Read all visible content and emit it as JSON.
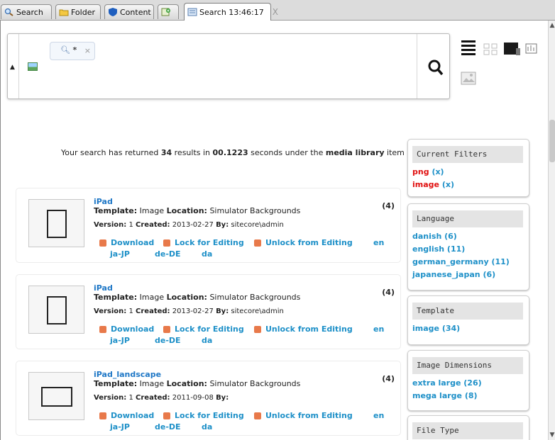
{
  "tabs": [
    {
      "label": "Search",
      "icon": "search-icon"
    },
    {
      "label": "Folder",
      "icon": "folder-icon"
    },
    {
      "label": "Content",
      "icon": "content-shield-icon"
    },
    {
      "label": "",
      "icon": "add-tab-icon"
    },
    {
      "label": "Search 13:46:17",
      "icon": "search-tab-icon",
      "close": "X"
    }
  ],
  "search": {
    "query": "*",
    "clear": "×"
  },
  "results": {
    "prefix": "Your search has returned ",
    "count": "34",
    "mid": " results in ",
    "time": "00.1223",
    "mid2": " seconds under the ",
    "location": "media library",
    "suffix": " item"
  },
  "items": [
    {
      "name": "iPad",
      "template_label": "Template:",
      "template": "Image",
      "location_label": "Location:",
      "location": "Simulator Backgrounds",
      "version_label": "Version:",
      "version": "1",
      "created_label": "Created:",
      "created": "2013-02-27",
      "by_label": "By:",
      "by": "sitecore\\admin",
      "count": "(4)",
      "download": "Download",
      "lock": "Lock for Editing",
      "unlock": "Unlock from Editing",
      "langs": [
        "en",
        "ja-JP",
        "de-DE",
        "da"
      ]
    },
    {
      "name": "iPad",
      "template_label": "Template:",
      "template": "Image",
      "location_label": "Location:",
      "location": "Simulator Backgrounds",
      "version_label": "Version:",
      "version": "1",
      "created_label": "Created:",
      "created": "2013-02-27",
      "by_label": "By:",
      "by": "sitecore\\admin",
      "count": "(4)",
      "download": "Download",
      "lock": "Lock for Editing",
      "unlock": "Unlock from Editing",
      "langs": [
        "en",
        "ja-JP",
        "de-DE",
        "da"
      ]
    },
    {
      "name": "iPad_landscape",
      "template_label": "Template:",
      "template": "Image",
      "location_label": "Location:",
      "location": "Simulator Backgrounds",
      "version_label": "Version:",
      "version": "1",
      "created_label": "Created:",
      "created": "2011-09-08",
      "by_label": "By:",
      "by": "",
      "count": "(4)",
      "download": "Download",
      "lock": "Lock for Editing",
      "unlock": "Unlock from Editing",
      "langs": [
        "en",
        "ja-JP",
        "de-DE",
        "da"
      ]
    }
  ],
  "facets": {
    "current": {
      "title": "Current Filters",
      "items": [
        {
          "name": "png",
          "remove": "(x)"
        },
        {
          "name": "image",
          "remove": "(x)"
        }
      ]
    },
    "language": {
      "title": "Language",
      "items": [
        "danish (6)",
        "english (11)",
        "german_germany (11)",
        "japanese_japan (6)"
      ]
    },
    "template": {
      "title": "Template",
      "items": [
        "image (34)"
      ]
    },
    "dimensions": {
      "title": "Image Dimensions",
      "items": [
        "extra large (26)",
        "mega large (8)"
      ]
    },
    "filetype": {
      "title": "File Type"
    }
  },
  "colors": {
    "link": "#1e90c8",
    "accent": "#e8794a",
    "filter_red": "#e01010"
  }
}
